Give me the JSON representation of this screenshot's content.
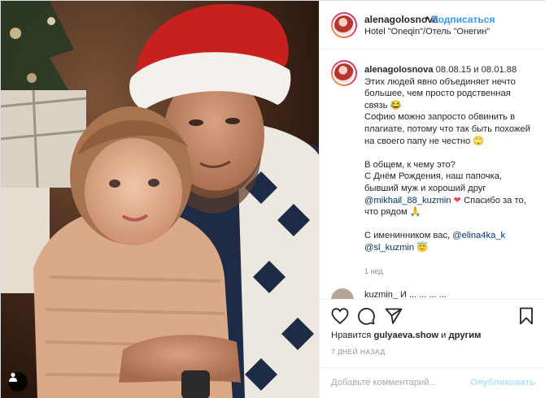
{
  "header": {
    "username": "alenagolosnova",
    "separator": "•",
    "follow_label": "Подписаться",
    "location": "Hotel \"Oneqin\"/Отель \"Онегин\""
  },
  "caption": {
    "username": "alenagolosnova",
    "text_1": " 08.08.15 и 08.01.88\nЭтих людей явно объединяет нечто большее, чем просто родственная связь 😂\nСофию можно запросто обвинить в плагиате, потому что так быть похожей на своего папу не честно 🙄\n\nВ общем, к чему это?\nС Днём Рождения, наш папочка, бывший муж и хороший друг ",
    "mention_1": "@mikhail_88_kuzmin",
    "heart": " ❤",
    "text_2": " Спасибо за то, что рядом 🙏\n\nС именинником вас, ",
    "mention_2": "@elina4ka_k",
    "text_3": "\n",
    "mention_3": "@sl_kuzmin",
    "text_4": " 😇",
    "time": "1 нед."
  },
  "next_comment": {
    "text": "kuzmin_ И ... ... ... ..."
  },
  "actions": {
    "like_icon": "heart-outline-icon",
    "comment_icon": "comment-bubble-icon",
    "share_icon": "paper-plane-icon",
    "save_icon": "bookmark-icon"
  },
  "likes": {
    "prefix": "Нравится ",
    "user": "gulyaeva.show",
    "suffix": " и ",
    "others": "другим"
  },
  "timeago": "7 ДНЕЙ НАЗАД",
  "add_comment": {
    "placeholder": "Добавьте комментарий...",
    "publish_label": "Опубликовать"
  },
  "colors": {
    "link_blue": "#3897f0",
    "mention": "#003569",
    "publish_disabled": "#b2dffc",
    "secondary_text": "#8e8e8e"
  }
}
